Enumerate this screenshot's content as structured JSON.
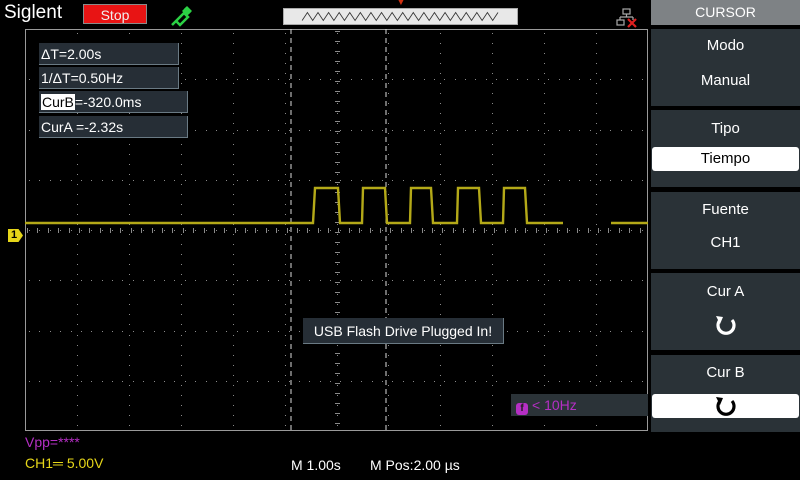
{
  "topbar": {
    "brand": "Siglent",
    "run_state": "Stop"
  },
  "readouts": {
    "delta_t": "ΔT=2.00s",
    "inv_delta_t": "1/ΔT=0.50Hz",
    "cur_b_label": "CurB",
    "cur_b_value": "=-320.0ms",
    "cur_a": "CurA =-2.32s"
  },
  "channel_marker": "1",
  "message": "USB Flash Drive Plugged In!",
  "freq": {
    "icon": "f",
    "text": "< 10Hz"
  },
  "bottom": {
    "vpp": "Vpp=****",
    "ch1_scale": "CH1═ 5.00V",
    "timebase": "M 1.00s",
    "mpos": "M Pos:2.00 µs"
  },
  "menu": {
    "title": "CURSOR",
    "mode_label": "Modo",
    "mode_value": "Manual",
    "type_label": "Tipo",
    "type_value": "Tiempo",
    "source_label": "Fuente",
    "source_value": "CH1",
    "cur_a_label": "Cur A",
    "cur_b_label": "Cur B"
  },
  "colors": {
    "ch1": "#e6d619",
    "math": "#b52fc4",
    "stop": "#e81414"
  }
}
